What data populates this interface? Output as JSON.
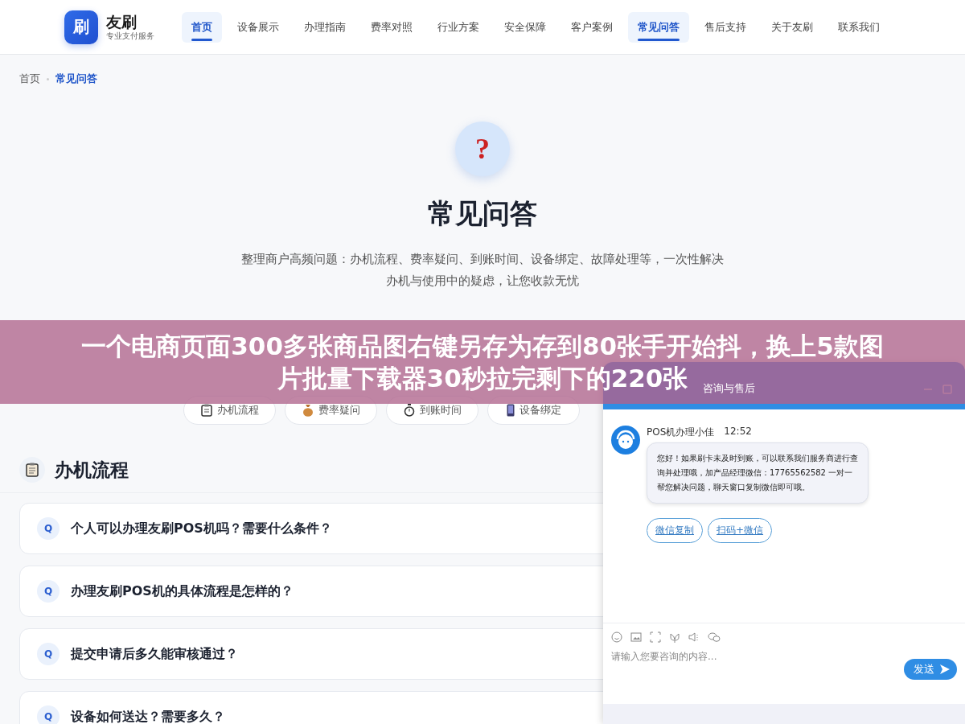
{
  "header": {
    "logo": {
      "mark": "刷",
      "name": "友刷",
      "tagline": "专业支付服务"
    },
    "nav": [
      {
        "label": "首页",
        "selected": true
      },
      {
        "label": "设备展示",
        "selected": false
      },
      {
        "label": "办理指南",
        "selected": false
      },
      {
        "label": "费率对照",
        "selected": false
      },
      {
        "label": "行业方案",
        "selected": false
      },
      {
        "label": "安全保障",
        "selected": false
      },
      {
        "label": "客户案例",
        "selected": false
      },
      {
        "label": "常见问答",
        "selected": true
      },
      {
        "label": "售后支持",
        "selected": false
      },
      {
        "label": "关于友刷",
        "selected": false
      },
      {
        "label": "联系我们",
        "selected": false
      }
    ]
  },
  "breadcrumb": [
    {
      "label": "首页",
      "selected": false
    },
    {
      "label": "常见问答",
      "selected": true
    }
  ],
  "hero": {
    "icon": "?",
    "title": "常见问答",
    "subtitle": "整理商户高频问题：办机流程、费率疑问、到账时间、设备绑定、故障处理等，一次性解决办机与使用中的疑虑，让您收款无忧"
  },
  "category_tabs": [
    {
      "kind": "clipboard",
      "label": "办机流程"
    },
    {
      "kind": "moneybag",
      "label": "费率疑问"
    },
    {
      "kind": "stopwatch",
      "label": "到账时间"
    },
    {
      "kind": "phone",
      "label": "设备绑定"
    }
  ],
  "section": {
    "title": "办机流程",
    "questions": [
      {
        "badge": "Q",
        "text": "个人可以办理友刷POS机吗？需要什么条件？"
      },
      {
        "badge": "Q",
        "text": "办理友刷POS机的具体流程是怎样的？"
      },
      {
        "badge": "Q",
        "text": "提交申请后多久能审核通过？"
      },
      {
        "badge": "Q",
        "text": "设备如何送达？需要多久？"
      }
    ]
  },
  "banner": {
    "lines": [
      "一个电商页面300多张商品图右键另存为存到80张手开始抖，换上5款图",
      "片批量下载器30秒拉完剩下的220张"
    ]
  },
  "chat": {
    "title": "咨询与售后",
    "message": {
      "sender": "POS机办理小佳",
      "time": "12:52",
      "text": "您好！如果刷卡未及时到账，可以联系我们服务商进行查询并处理哦，加产品经理微信：17765562582 一对一帮您解决问题，聊天窗口复制微信即可哦。"
    },
    "actions": [
      "微信复制",
      "扫码+微信"
    ],
    "input": {
      "placeholder": "请输入您要咨询的内容..."
    },
    "send": "发送"
  }
}
